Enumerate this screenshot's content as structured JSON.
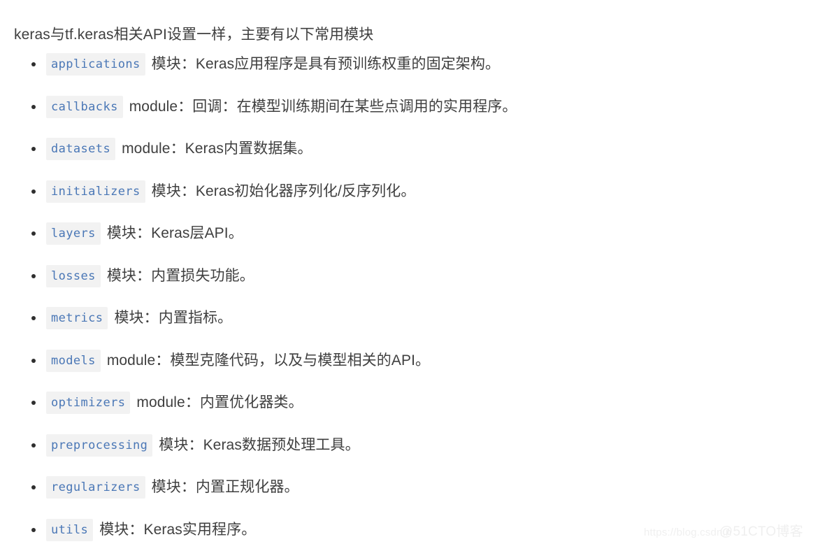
{
  "document": {
    "intro": "keras与tf.keras相关API设置一样，主要有以下常用模块",
    "bullet_glyph": "•"
  },
  "modules": [
    {
      "code": "applications",
      "description": "模块：Keras应用程序是具有预训练权重的固定架构。"
    },
    {
      "code": "callbacks",
      "description": "module：回调：在模型训练期间在某些点调用的实用程序。"
    },
    {
      "code": "datasets",
      "description": "module：Keras内置数据集。"
    },
    {
      "code": "initializers",
      "description": "模块：Keras初始化器序列化/反序列化。"
    },
    {
      "code": "layers",
      "description": "模块：Keras层API。"
    },
    {
      "code": "losses",
      "description": "模块：内置损失功能。"
    },
    {
      "code": "metrics",
      "description": "模块：内置指标。"
    },
    {
      "code": "models",
      "description": "module：模型克隆代码，以及与模型相关的API。"
    },
    {
      "code": "optimizers",
      "description": "module：内置优化器类。"
    },
    {
      "code": "preprocessing",
      "description": "模块：Keras数据预处理工具。"
    },
    {
      "code": "regularizers",
      "description": "模块：内置正规化器。"
    },
    {
      "code": "utils",
      "description": "模块：Keras实用程序。"
    }
  ],
  "watermark": {
    "url_text": "https://blog.csdn.n",
    "brand_text": "@51CTO博客"
  },
  "colors": {
    "page_background": "#ffffff",
    "body_text": "#3f3f3f",
    "code_text": "#4a77b6",
    "code_background": "#f2f2f2",
    "bullet": "#2f2f2f",
    "watermark": "#f0f0f0"
  }
}
